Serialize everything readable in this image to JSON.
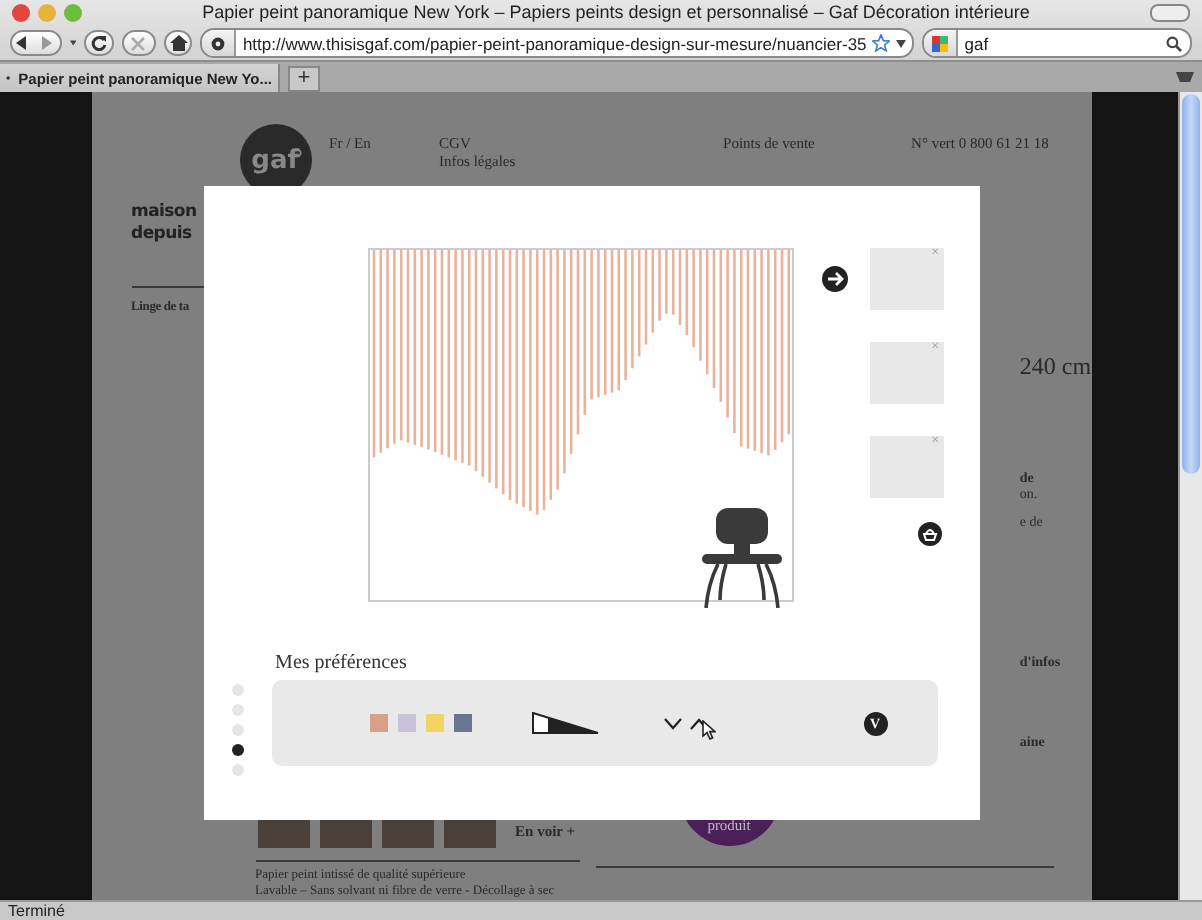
{
  "window": {
    "title": "Papier peint panoramique New York – Papiers peints design et personnalisé – Gaf Décoration intérieure"
  },
  "toolbar": {
    "url": "http://www.thisisgaf.com/papier-peint-panoramique-design-sur-mesure/nuancier-35",
    "search": "gaf"
  },
  "tabs": [
    {
      "label": "Papier peint panoramique New Yo...",
      "selected": true
    }
  ],
  "new_tab": "+",
  "page": {
    "logo": "gaf",
    "language": "Fr / En",
    "legal_links": [
      "CGV",
      "Infos légales"
    ],
    "stores": "Points de vente",
    "phone": "N° vert 0 800 61 21 18",
    "heading_lines": [
      "maison",
      "depuis"
    ],
    "section": "Linge de ta",
    "side_fragments": [
      "240 cm",
      "de",
      "on.",
      "e de",
      "d'infos",
      "aine"
    ],
    "more_link": "En voir +",
    "badge": "produit",
    "description": [
      "Papier peint intissé de qualité supérieure",
      "Lavable – Sans solvant ni fibre de verre - Décollage à sec"
    ]
  },
  "modal": {
    "saved_items": [
      {
        "remove": "×"
      },
      {
        "remove": "×"
      },
      {
        "remove": "×"
      }
    ],
    "preferences_title": "Mes préférences",
    "steps": [
      {
        "selected": false
      },
      {
        "selected": false
      },
      {
        "selected": false
      },
      {
        "selected": true
      },
      {
        "selected": false
      }
    ],
    "swatches": [
      {
        "color": "#d9a088"
      },
      {
        "color": "#c9c3da"
      },
      {
        "color": "#f2d466"
      },
      {
        "color": "#6a7591"
      }
    ],
    "confirm": "V"
  },
  "status_bar": "Terminé"
}
